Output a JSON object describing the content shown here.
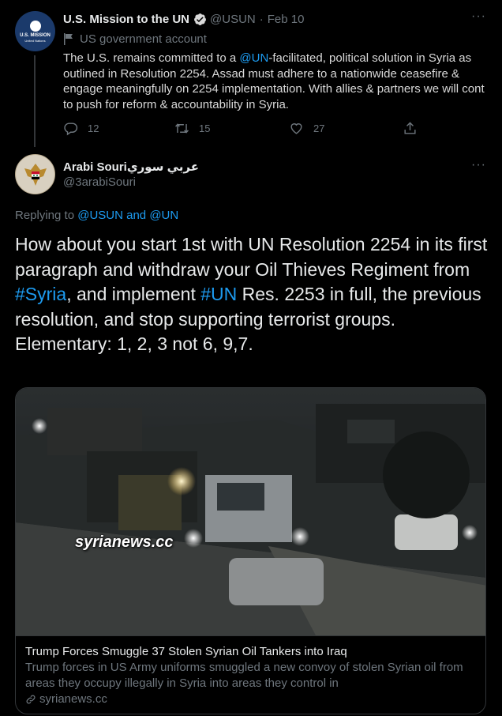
{
  "tweet1": {
    "author_name": "U.S. Mission to the UN",
    "handle": "@USUN",
    "date": "Feb 10",
    "label": "US government account",
    "avatar_text": "U.S. MISSION",
    "avatar_sub": "United Nations",
    "text_parts": [
      "The U.S. remains committed to a ",
      "@UN",
      "-facilitated, political solution in Syria as outlined in Resolution 2254. Assad must adhere to a nationwide ceasefire & engage meaningfully on 2254 implementation. With allies & partners we will cont to push for reform & accountability in Syria."
    ],
    "reply_count": "12",
    "retweet_count": "15",
    "like_count": "27"
  },
  "tweet2": {
    "author_name": "Arabi Souriعربي سوري",
    "handle": "@3arabiSouri",
    "replying_prefix": "Replying to ",
    "replying_to_1": "@USUN",
    "replying_and": " and ",
    "replying_to_2": "@UN",
    "text_parts": [
      "How about you start 1st with UN Resolution 2254 in its first paragraph and withdraw your Oil Thieves Regiment from ",
      "#Syria",
      ", and implement ",
      "#UN",
      " Res. 2253 in full, the previous resolution, and stop supporting terrorist groups.",
      "Elementary: 1, 2, 3 not 6, 9,7."
    ]
  },
  "card": {
    "watermark": "syrianews.cc",
    "title": "Trump Forces Smuggle 37 Stolen Syrian Oil Tankers into Iraq",
    "description": "Trump forces in US Army uniforms smuggled a new convoy of stolen Syrian oil from areas they occupy illegally in Syria into areas they control in",
    "domain": "syrianews.cc"
  },
  "icons": {
    "more": "more-horizontal-icon",
    "reply": "reply-icon",
    "retweet": "retweet-icon",
    "like": "like-icon",
    "share": "share-icon",
    "verified": "verified-badge-icon",
    "flag": "flag-icon",
    "link": "link-icon"
  },
  "colors": {
    "background": "#000000",
    "link": "#1d9bf0",
    "muted": "#6e767d",
    "verified": "#d9d9d9"
  }
}
